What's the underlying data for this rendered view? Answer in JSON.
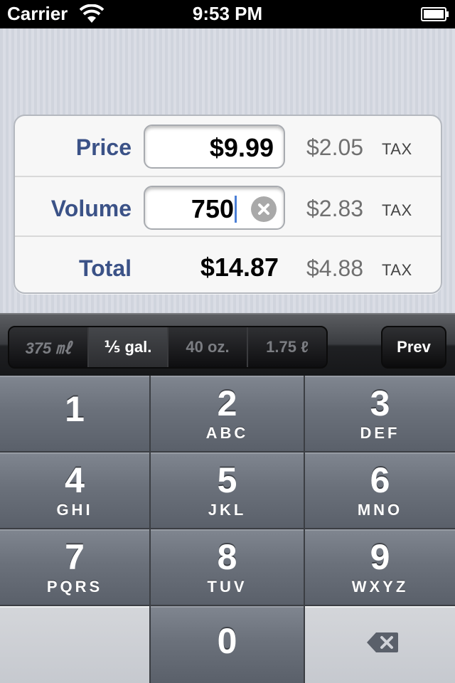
{
  "status_bar": {
    "carrier": "Carrier",
    "time": "9:53 PM",
    "icons": [
      "wifi-icon",
      "battery-icon"
    ]
  },
  "calculator": {
    "rows": [
      {
        "label": "Price",
        "value": "$9.99",
        "tax_amount": "$2.05",
        "tax_label": "TAX"
      },
      {
        "label": "Volume",
        "value": "750",
        "tax_amount": "$2.83",
        "tax_label": "TAX"
      },
      {
        "label": "Total",
        "value": "$14.87",
        "tax_amount": "$4.88",
        "tax_label": "TAX"
      }
    ]
  },
  "toolbar": {
    "segments": [
      {
        "label": "375 ㎖",
        "selected": false
      },
      {
        "label": "⅕ gal.",
        "selected": true
      },
      {
        "label": "40 oz.",
        "selected": false
      },
      {
        "label": "1.75 ℓ",
        "selected": false
      }
    ],
    "prev_label": "Prev"
  },
  "keypad": {
    "keys": [
      {
        "digit": "1",
        "letters": ""
      },
      {
        "digit": "2",
        "letters": "ABC"
      },
      {
        "digit": "3",
        "letters": "DEF"
      },
      {
        "digit": "4",
        "letters": "GHI"
      },
      {
        "digit": "5",
        "letters": "JKL"
      },
      {
        "digit": "6",
        "letters": "MNO"
      },
      {
        "digit": "7",
        "letters": "PQRS"
      },
      {
        "digit": "8",
        "letters": "TUV"
      },
      {
        "digit": "9",
        "letters": "WXYZ"
      },
      {
        "digit": "0",
        "letters": ""
      }
    ],
    "delete_icon": "backspace-icon"
  },
  "colors": {
    "label_blue": "#3b5287",
    "tax_gray": "#707070",
    "caret_blue": "#4b7fd6"
  }
}
